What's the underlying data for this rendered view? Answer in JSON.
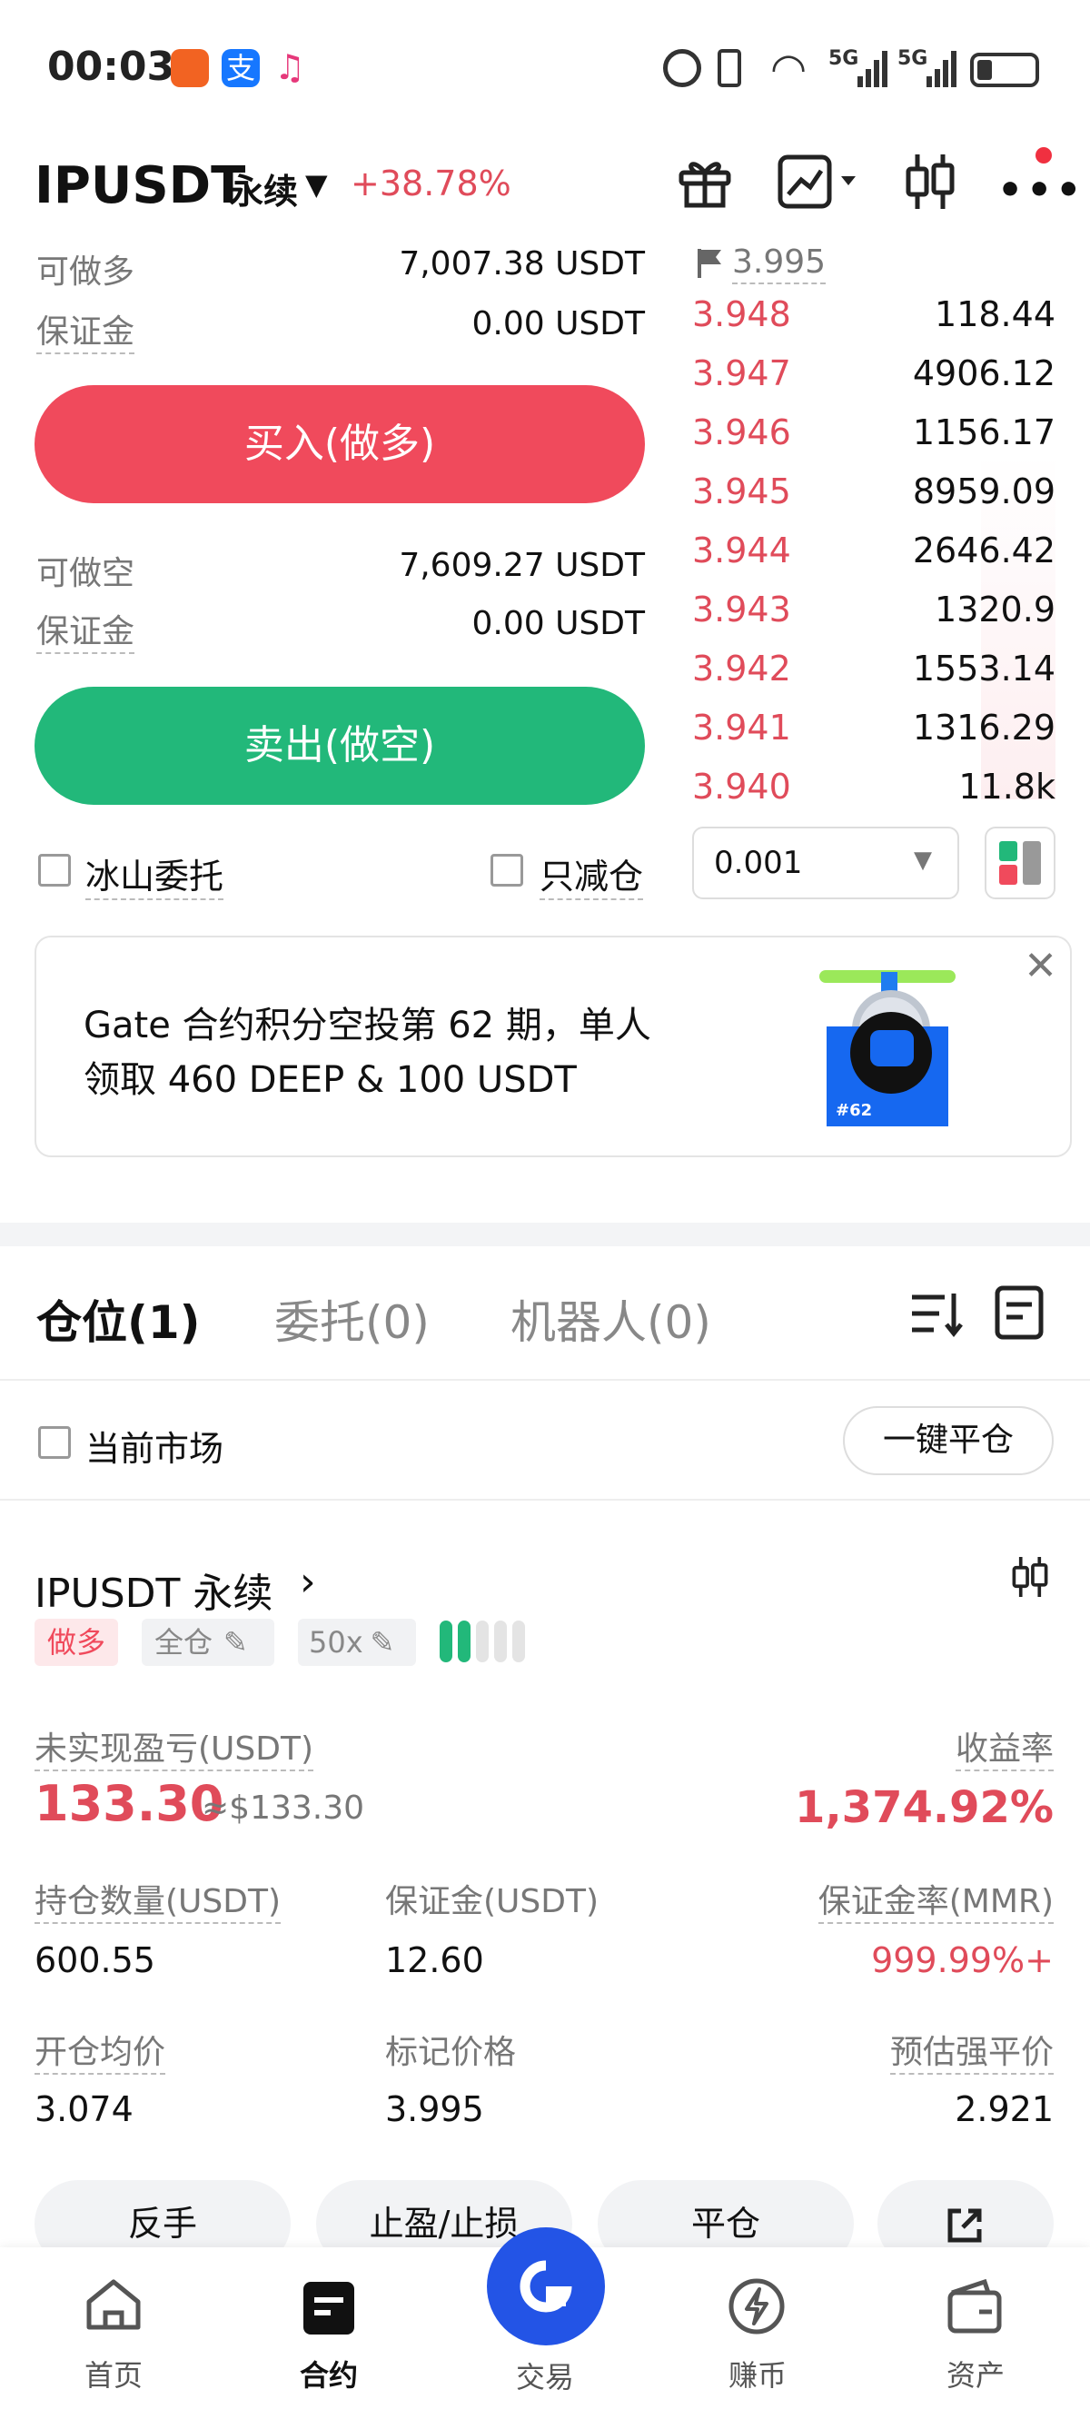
{
  "status_bar": {
    "time": "00:03",
    "net1": "5G",
    "net2": "5G"
  },
  "header": {
    "symbol": "IPUSDT",
    "contract_type": "永续",
    "change": "+38.78%"
  },
  "long": {
    "avail_label": "可做多",
    "avail_value": "7,007.38 USDT",
    "margin_label": "保证金",
    "margin_value": "0.00 USDT",
    "button": "买入(做多)"
  },
  "short": {
    "avail_label": "可做空",
    "avail_value": "7,609.27 USDT",
    "margin_label": "保证金",
    "margin_value": "0.00 USDT",
    "button": "卖出(做空)"
  },
  "options": {
    "iceberg": "冰山委托",
    "reduce_only": "只减仓"
  },
  "orderbook": {
    "mark_price": "3.995",
    "asks": [
      {
        "price": "3.948",
        "qty": "118.44"
      },
      {
        "price": "3.947",
        "qty": "4906.12"
      },
      {
        "price": "3.946",
        "qty": "1156.17"
      },
      {
        "price": "3.945",
        "qty": "8959.09"
      },
      {
        "price": "3.944",
        "qty": "2646.42"
      },
      {
        "price": "3.943",
        "qty": "1320.9"
      },
      {
        "price": "3.942",
        "qty": "1553.14"
      },
      {
        "price": "3.941",
        "qty": "1316.29"
      },
      {
        "price": "3.940",
        "qty": "11.8k"
      }
    ],
    "precision": "0.001"
  },
  "banner": {
    "line1": "Gate 合约积分空投第 62 期，单人",
    "line2": "领取 460 DEEP & 100 USDT",
    "badge": "#62"
  },
  "tabs": {
    "positions": "仓位(1)",
    "orders": "委托(0)",
    "bots": "机器人(0)"
  },
  "filter": {
    "current_market": "当前市场",
    "close_all": "一键平仓"
  },
  "position": {
    "title": "IPUSDT 永续",
    "side": "做多",
    "mode": "全仓",
    "leverage": "50x",
    "pnl_label": "未实现盈亏(USDT)",
    "pnl_value": "133.30",
    "pnl_usd": "≈$133.30",
    "roe_label": "收益率",
    "roe_value": "1,374.92%",
    "size_label": "持仓数量(USDT)",
    "size_value": "600.55",
    "margin_label": "保证金(USDT)",
    "margin_value": "12.60",
    "mmr_label": "保证金率(MMR)",
    "mmr_value": "999.99%+",
    "entry_label": "开仓均价",
    "entry_value": "3.074",
    "mark_label": "标记价格",
    "mark_value": "3.995",
    "liq_label": "预估强平价",
    "liq_value": "2.921",
    "btn_reverse": "反手",
    "btn_tpsl": "止盈/止损",
    "btn_close": "平仓"
  },
  "nav": [
    {
      "label": "首页"
    },
    {
      "label": "合约"
    },
    {
      "label": "交易"
    },
    {
      "label": "赚币"
    },
    {
      "label": "资产"
    }
  ],
  "colors": {
    "red": "#f04a5c",
    "green": "#22b87a",
    "blue": "#2354e6"
  }
}
